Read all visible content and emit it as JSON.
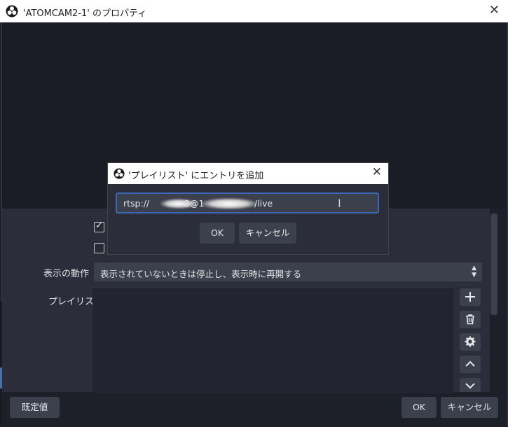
{
  "window": {
    "title": "'ATOMCAM2-1' のプロパティ",
    "close_glyph": "✕",
    "app_icon": "obs-logo-icon"
  },
  "checkboxes": [
    {
      "checked": true
    },
    {
      "checked": false
    }
  ],
  "properties": {
    "visibility_label": "表示の動作",
    "visibility_value": "表示されていないときは停止し、表示時に再開する",
    "playlist_label": "プレイリスト"
  },
  "side_buttons": [
    {
      "icon": "plus-icon"
    },
    {
      "icon": "trash-icon"
    },
    {
      "icon": "gear-icon"
    },
    {
      "icon": "chevron-up-icon"
    },
    {
      "icon": "chevron-down-icon"
    }
  ],
  "footer": {
    "defaults_label": "既定値",
    "ok_label": "OK",
    "cancel_label": "キャンセル"
  },
  "dialog": {
    "title": "'プレイリスト' にエントリを追加",
    "close_glyph": "✕",
    "url_value": "rtsp://          2@1      .      /live",
    "url_prefix": "rtsp://",
    "url_mid": "2@1",
    "url_suffix": "/live",
    "ok_label": "OK",
    "cancel_label": "キャンセル"
  },
  "colors": {
    "accent": "#3b67b4",
    "background": "#1e2029",
    "panel": "#2b2e3a",
    "button": "#3c3f4c"
  }
}
